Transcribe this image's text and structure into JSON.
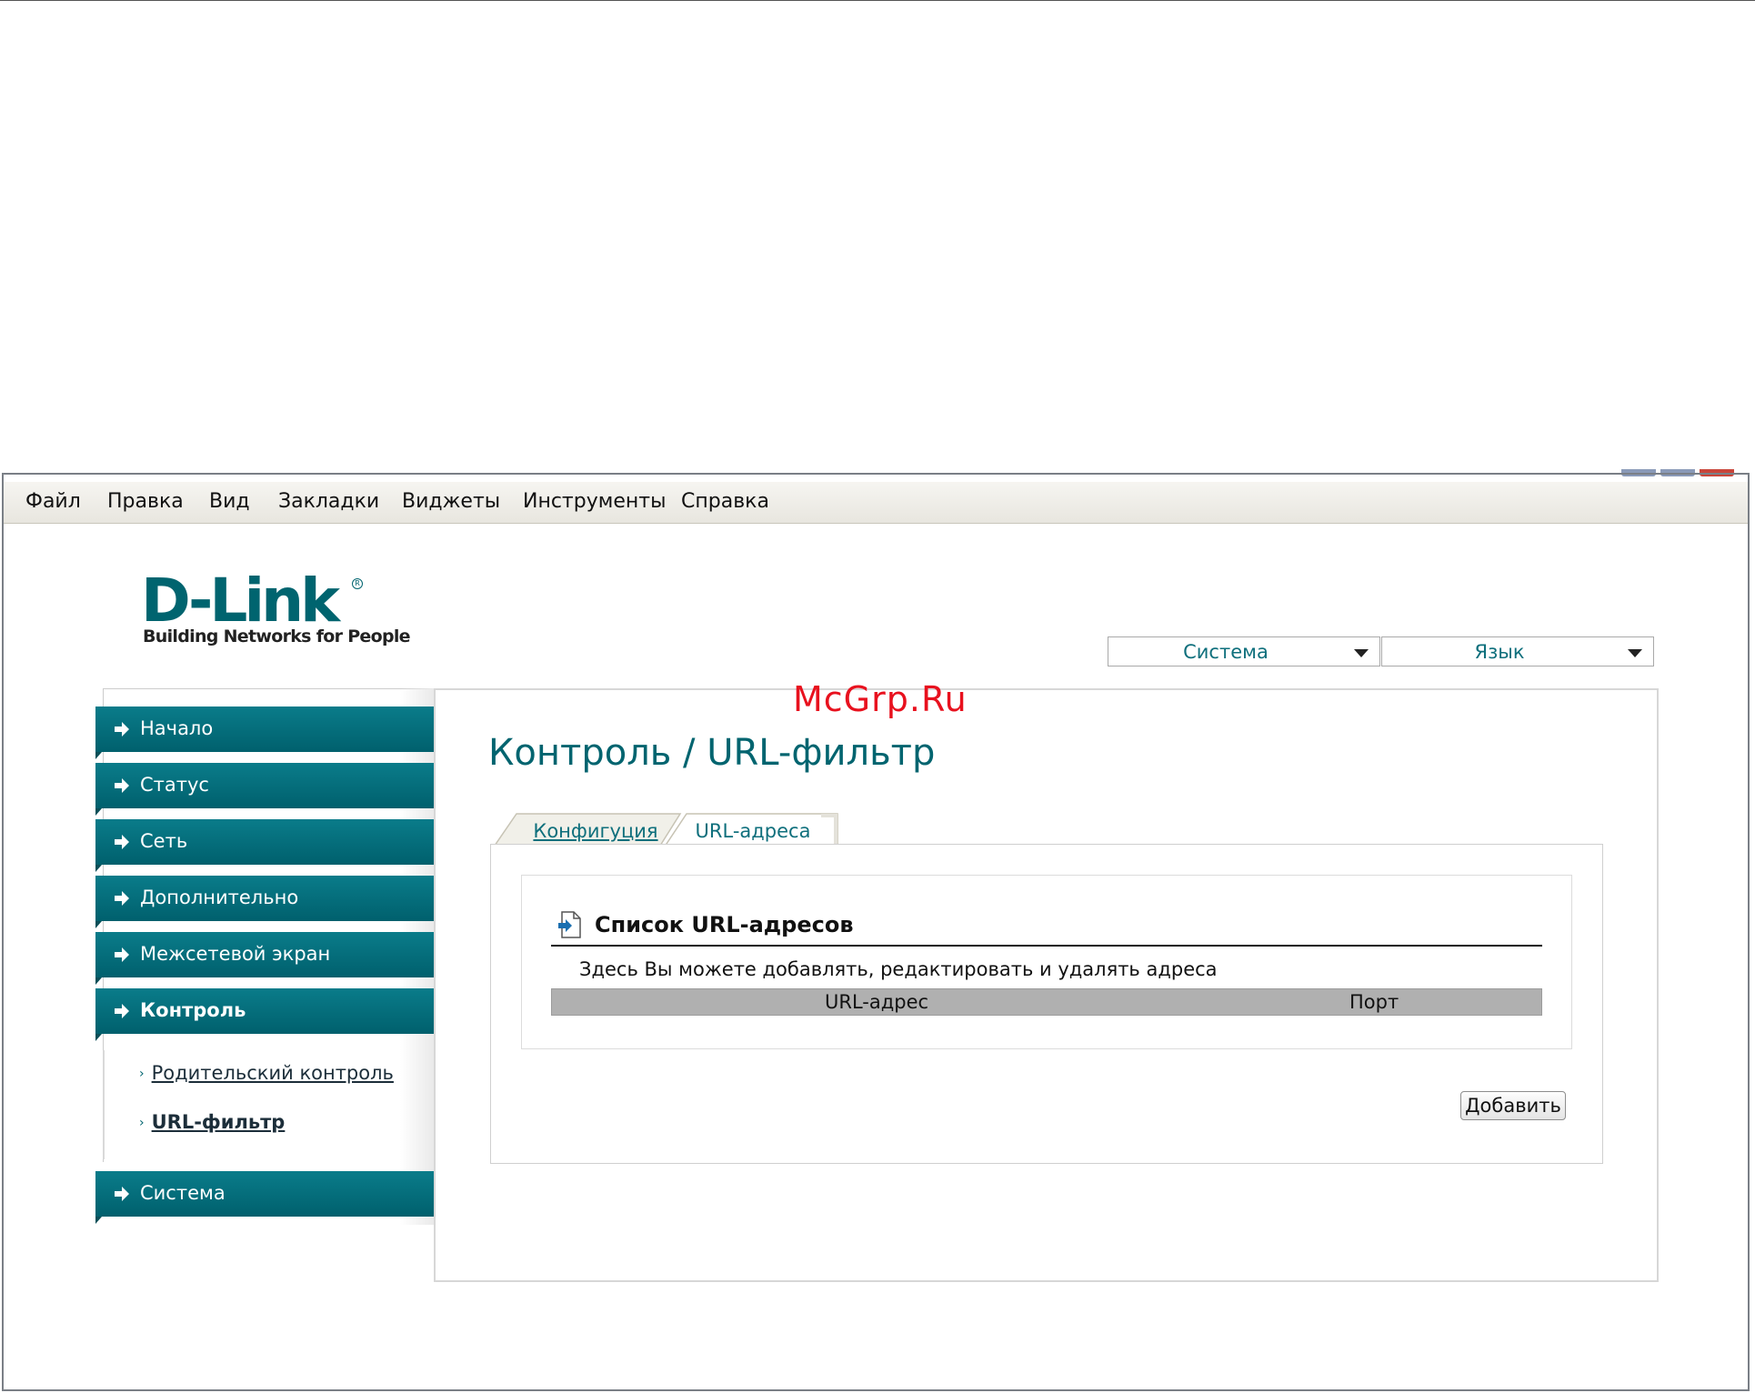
{
  "menubar": {
    "items": [
      "Файл",
      "Правка",
      "Вид",
      "Закладки",
      "Виджеты",
      "Инструменты",
      "Справка"
    ]
  },
  "logo": {
    "brand": "D-Link",
    "tagline": "Building Networks for People"
  },
  "header": {
    "system_select": "Система",
    "language_select": "Язык"
  },
  "watermark": "McGrp.Ru",
  "sidebar": {
    "items": [
      {
        "label": "Начало",
        "icon": "arrow-right-icon"
      },
      {
        "label": "Статус",
        "icon": "arrow-right-icon"
      },
      {
        "label": "Сеть",
        "icon": "arrow-right-icon"
      },
      {
        "label": "Дополнительно",
        "icon": "arrow-right-icon"
      },
      {
        "label": "Межсетевой экран",
        "icon": "arrow-right-icon"
      },
      {
        "label": "Контроль",
        "icon": "arrow-right-icon",
        "active": true
      },
      {
        "label": "Система",
        "icon": "arrow-right-icon"
      }
    ],
    "subitems": [
      {
        "label": "Родительский контроль"
      },
      {
        "label": "URL-фильтр",
        "active": true
      }
    ]
  },
  "main": {
    "title": "Контроль /  URL-фильтр",
    "tabs": [
      {
        "label": "Конфигуция"
      },
      {
        "label": "URL-адреса",
        "active": true
      }
    ],
    "section": {
      "title": "Список URL-адресов",
      "description": "Здесь Вы можете добавлять, редактировать и удалять адреса",
      "columns": [
        "URL-адрес",
        "Порт"
      ],
      "rows": []
    },
    "add_button": "Добавить"
  },
  "colors": {
    "brand_teal": "#00646f",
    "nav_teal": "#0a7c8a",
    "link_teal": "#0e6f7c",
    "watermark_red": "#e8111e"
  }
}
